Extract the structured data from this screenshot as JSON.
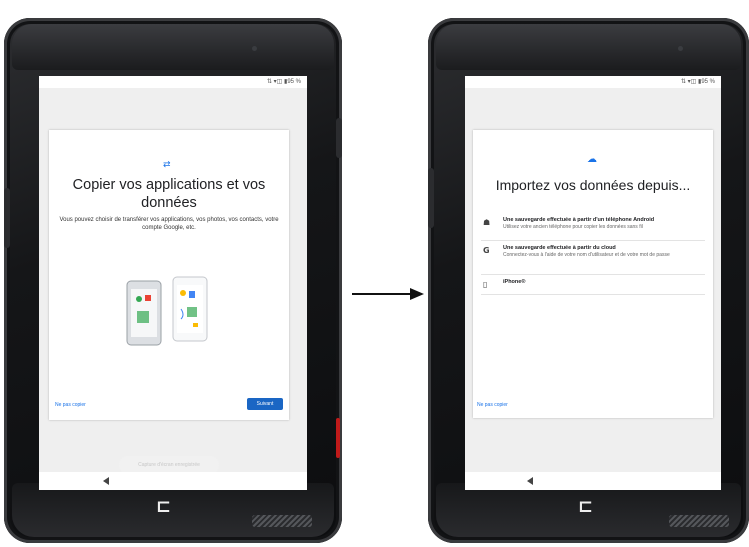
{
  "left_screen": {
    "status": "⇅ ▾◫ ▮95 %",
    "title": "Copier vos applications et vos données",
    "description": "Vous pouvez choisir de transférer vos applications, vos photos, vos contacts, votre compte Google, etc.",
    "skip_label": "Ne pas copier",
    "next_label": "Suivant",
    "capture_label": "Capture d'écran enregistrée"
  },
  "right_screen": {
    "status": "⇅ ▾◫ ▮95 %",
    "title": "Importez vos données depuis...",
    "options": [
      {
        "icon": "android-icon",
        "title": "Une sauvegarde effectuée à partir d'un téléphone Android",
        "description": "Utilisez votre ancien téléphone pour copier les données sans fil"
      },
      {
        "icon": "google-icon",
        "title": "Une sauvegarde effectuée à partir du cloud",
        "description": "Connectez-vous à l'aide de votre nom d'utilisateur et de votre mot de passe"
      },
      {
        "icon": "phone-icon",
        "title": "iPhone®",
        "description": ""
      }
    ],
    "skip_label": "Ne pas copier"
  },
  "colors": {
    "accent": "#1a66c4",
    "link": "#1a73e8",
    "device_body": "#151618"
  }
}
